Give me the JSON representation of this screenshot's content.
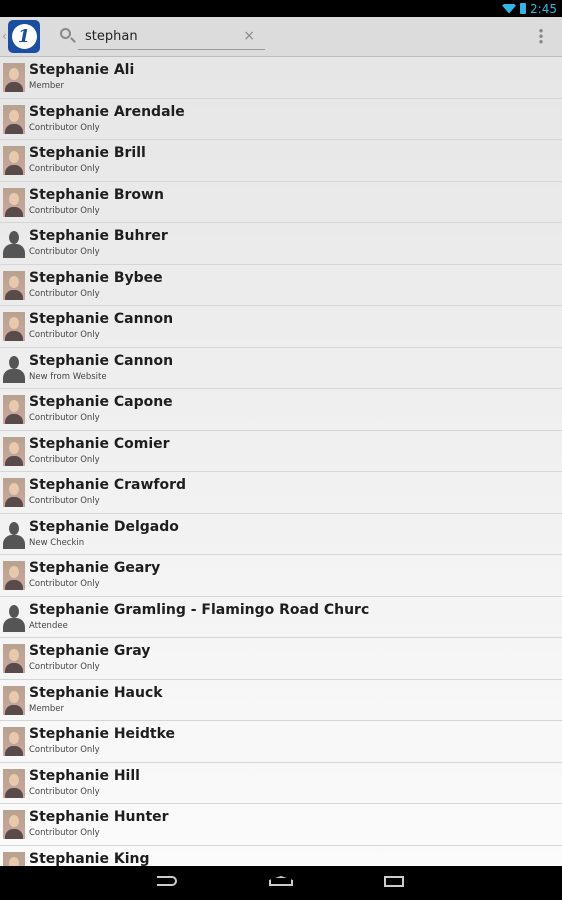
{
  "status_bar": {
    "time": "2:45"
  },
  "action_bar": {
    "search_value": "stephan",
    "clear_icon": "×"
  },
  "contacts": [
    {
      "name": "Stephanie Ali",
      "role": "Member",
      "avatar": "photo"
    },
    {
      "name": "Stephanie Arendale",
      "role": "Contributor Only",
      "avatar": "photo"
    },
    {
      "name": "Stephanie Brill",
      "role": "Contributor Only",
      "avatar": "photo"
    },
    {
      "name": "Stephanie Brown",
      "role": "Contributor Only",
      "avatar": "photo"
    },
    {
      "name": "Stephanie Buhrer",
      "role": "Contributor Only",
      "avatar": "silhouette"
    },
    {
      "name": "Stephanie Bybee",
      "role": "Contributor Only",
      "avatar": "photo"
    },
    {
      "name": "Stephanie Cannon",
      "role": "Contributor Only",
      "avatar": "photo"
    },
    {
      "name": "Stephanie Cannon",
      "role": "New from Website",
      "avatar": "silhouette"
    },
    {
      "name": "Stephanie Capone",
      "role": "Contributor Only",
      "avatar": "photo"
    },
    {
      "name": "Stephanie Comier",
      "role": "Contributor Only",
      "avatar": "photo"
    },
    {
      "name": "Stephanie Crawford",
      "role": "Contributor Only",
      "avatar": "photo"
    },
    {
      "name": "Stephanie Delgado",
      "role": "New Checkin",
      "avatar": "silhouette"
    },
    {
      "name": "Stephanie Geary",
      "role": "Contributor Only",
      "avatar": "photo"
    },
    {
      "name": "Stephanie Gramling - Flamingo Road Churc",
      "role": "Attendee",
      "avatar": "silhouette"
    },
    {
      "name": "Stephanie Gray",
      "role": "Contributor Only",
      "avatar": "photo"
    },
    {
      "name": "Stephanie Hauck",
      "role": "Member",
      "avatar": "photo"
    },
    {
      "name": "Stephanie Heidtke",
      "role": "Contributor Only",
      "avatar": "photo"
    },
    {
      "name": "Stephanie Hill",
      "role": "Contributor Only",
      "avatar": "photo"
    },
    {
      "name": "Stephanie Hunter",
      "role": "Contributor Only",
      "avatar": "photo"
    },
    {
      "name": "Stephanie King",
      "role": "",
      "avatar": "photo"
    }
  ]
}
